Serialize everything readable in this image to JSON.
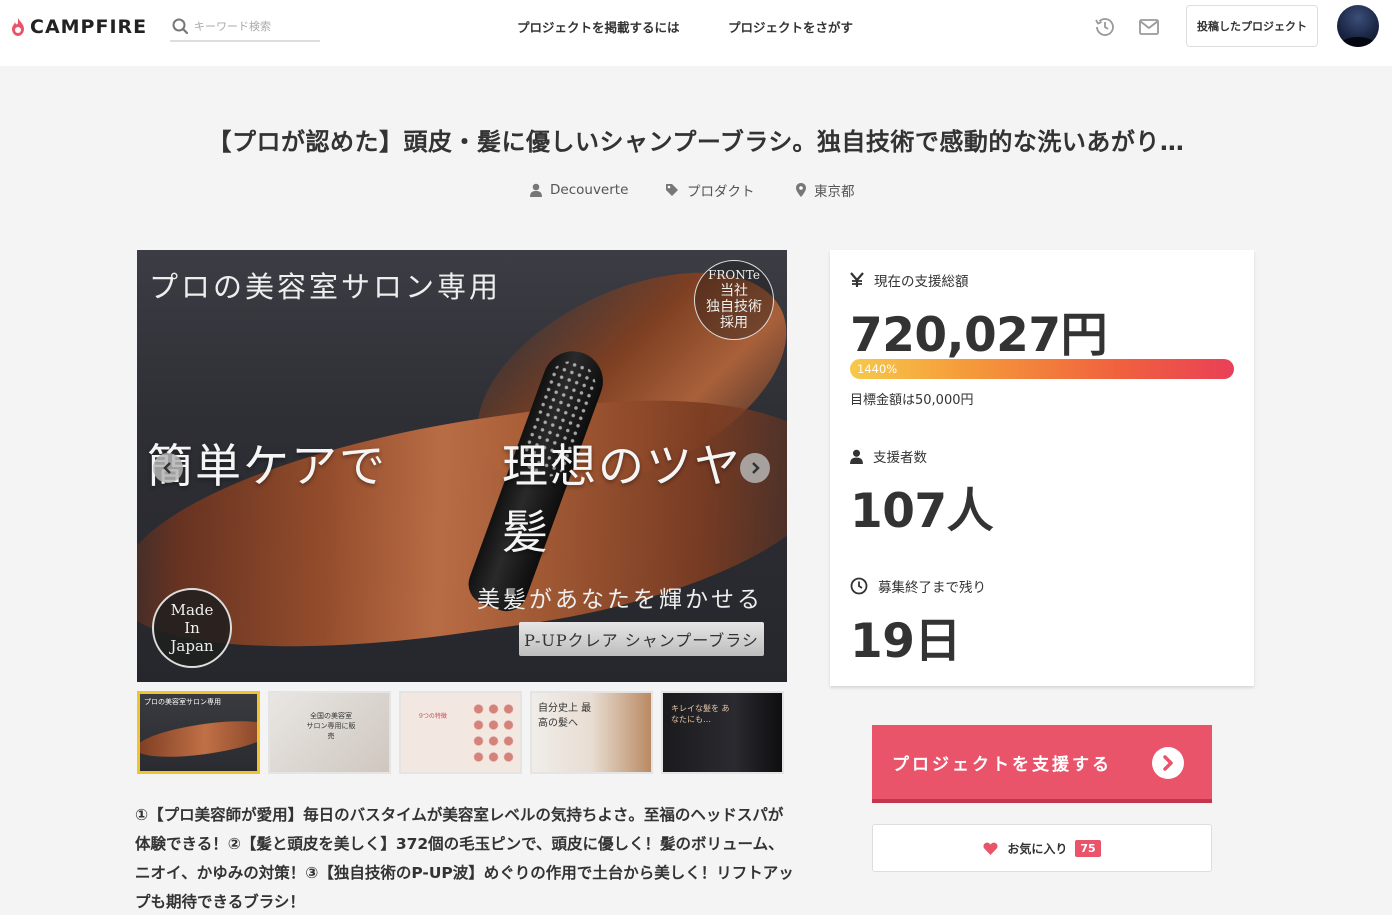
{
  "header": {
    "brand": "CAMPFIRE",
    "search_placeholder": "キーワード検索",
    "nav_publish": "プロジェクトを掲載するには",
    "nav_find": "プロジェクトをさがす",
    "posted_projects": "投稿したプロジェクト",
    "icons": [
      "history-icon",
      "mail-icon"
    ]
  },
  "project": {
    "title": "【プロが認めた】頭皮・髪に優しいシャンプーブラシ。独自技術で感動的な洗いあがり…",
    "owner": "Decouverte",
    "category": "プロダクト",
    "location": "東京都"
  },
  "main_image": {
    "headline": "プロの美容室サロン専用",
    "left_text": "簡単ケアで",
    "right_text": "理想のツヤ髪",
    "sub_text": "美髪があなたを輝かせる",
    "product_label": "P-UPクレア シャンプーブラシ",
    "badge_brand": "FRONTe",
    "badge_lines": [
      "当社",
      "独自技術",
      "採用"
    ],
    "made_in": [
      "Made",
      "In",
      "Japan"
    ]
  },
  "thumbnails": [
    {
      "text": "プロの美容室サロン専用"
    },
    {
      "text": "全国の美容室 サロン専用に販売"
    },
    {
      "text": "9つの特徴"
    },
    {
      "text": "自分史上 最高の髪へ"
    },
    {
      "text": "キレイな髪を あなたにも…"
    }
  ],
  "description": "①【プロ美容師が愛用】毎日のバスタイムが美容室レベルの気持ちよさ。至福のヘッドスパが体験できる！②【髪と頭皮を美しく】372個の毛玉ピンで、頭皮に優しく！髪のボリューム、ニオイ、かゆみの対策！③【独自技術のP-UP波】めぐりの作用で土台から美しく！リフトアップも期待できるブラシ！",
  "stats": {
    "total_label": "現在の支援総額",
    "total_value": "720,027円",
    "percent": "1440%",
    "progress_fraction": 1.0,
    "goal": "目標金額は50,000円",
    "supporters_label": "支援者数",
    "supporters_value": "107人",
    "remaining_label": "募集終了まで残り",
    "remaining_value": "19日"
  },
  "actions": {
    "support": "プロジェクトを支援する",
    "favorite": "お気に入り",
    "favorite_count": "75"
  },
  "colors": {
    "accent": "#e9546b",
    "thumb_active": "#f0c430"
  }
}
